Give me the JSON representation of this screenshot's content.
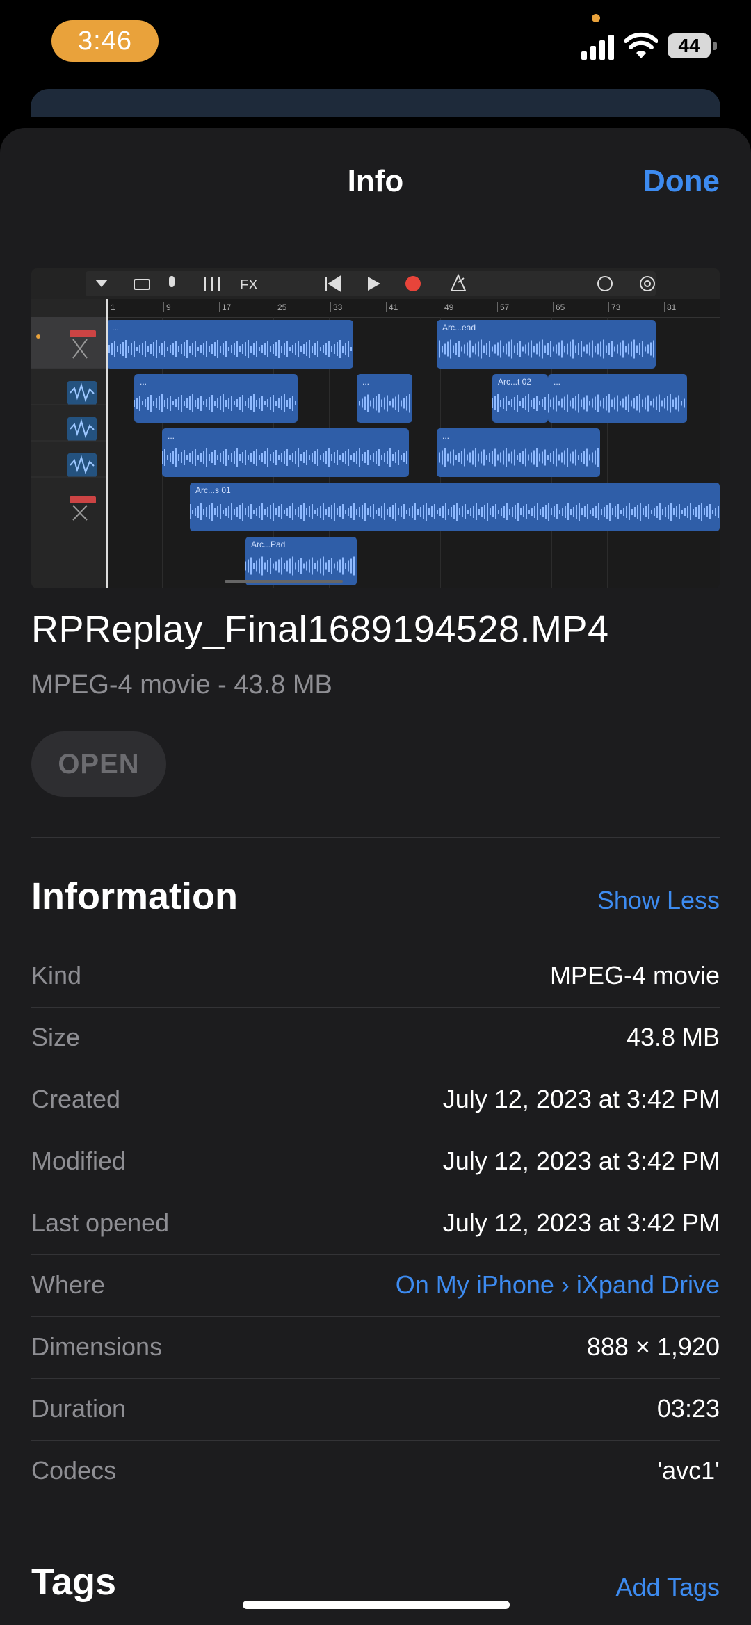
{
  "status_bar": {
    "time": "3:46",
    "battery": "44"
  },
  "nav": {
    "title": "Info",
    "done_label": "Done"
  },
  "file": {
    "name": "RPReplay_Final1689194528.MP4",
    "subtitle": "MPEG-4 movie - 43.8 MB",
    "open_label": "OPEN"
  },
  "thumbnail": {
    "ruler_marks": [
      "1",
      "9",
      "17",
      "25",
      "33",
      "41",
      "49",
      "57",
      "65",
      "73",
      "81"
    ],
    "toolbar_fx": "FX",
    "region_labels": [
      "...",
      "Arc...ead",
      "...",
      "...",
      "Arc...t 02",
      "...",
      "...",
      "...",
      "Arc...s 01",
      "Arc...Pad"
    ]
  },
  "information": {
    "title": "Information",
    "toggle_label": "Show Less",
    "rows": [
      {
        "key": "Kind",
        "value": "MPEG-4 movie"
      },
      {
        "key": "Size",
        "value": "43.8 MB"
      },
      {
        "key": "Created",
        "value": "July 12, 2023 at 3:42 PM"
      },
      {
        "key": "Modified",
        "value": "July 12, 2023 at 3:42 PM"
      },
      {
        "key": "Last opened",
        "value": "July 12, 2023 at 3:42 PM"
      },
      {
        "key": "Where",
        "value": "On My iPhone › iXpand Drive"
      },
      {
        "key": "Dimensions",
        "value": "888 × 1,920"
      },
      {
        "key": "Duration",
        "value": "03:23"
      },
      {
        "key": "Codecs",
        "value": "'avc1'"
      }
    ]
  },
  "tags": {
    "title": "Tags",
    "add_label": "Add Tags"
  },
  "colors": {
    "accent": "#3d8bf0",
    "time_pill": "#e9a23b",
    "sheet": "#1c1c1e",
    "region": "#2f5ea8"
  }
}
